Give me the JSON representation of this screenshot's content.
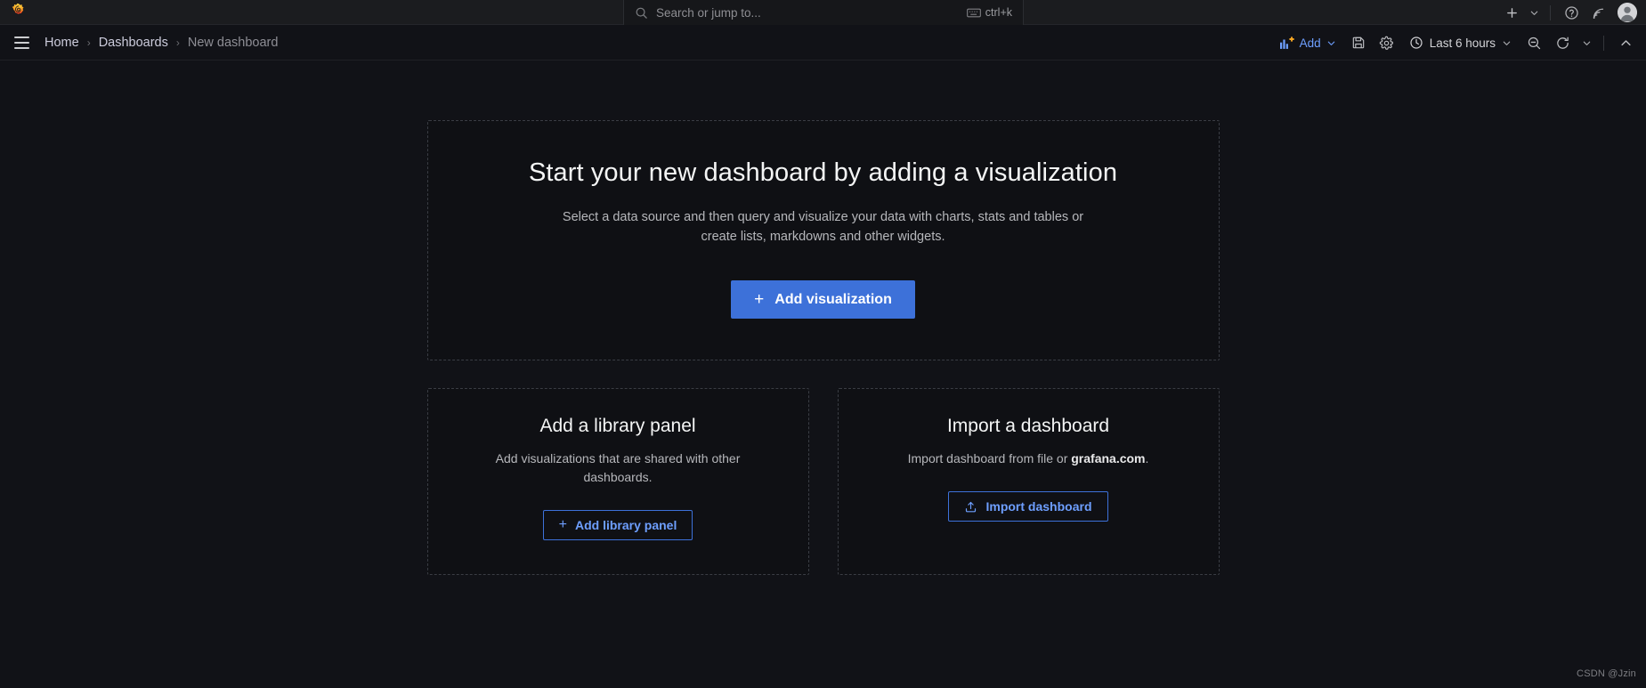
{
  "topbar": {
    "logo_icon": "grafana-logo",
    "search": {
      "placeholder": "Search or jump to...",
      "icon": "search-icon",
      "shortcut_label": "ctrl+k",
      "shortcut_icon": "keyboard-icon"
    },
    "actions": {
      "new_icon": "plus-icon",
      "new_chevron_icon": "chevron-down-icon",
      "help_icon": "help-circle-icon",
      "news_icon": "rss-icon",
      "profile_icon": "avatar"
    }
  },
  "navbar": {
    "menu_icon": "hamburger-menu-icon",
    "breadcrumb": [
      {
        "label": "Home",
        "current": false
      },
      {
        "label": "Dashboards",
        "current": false
      },
      {
        "label": "New dashboard",
        "current": true
      }
    ],
    "separator": "›",
    "add_label": "Add",
    "add_icon": "panel-add-icon",
    "add_chevron_icon": "chevron-down-icon",
    "save_icon": "save-floppy-icon",
    "settings_icon": "gear-icon",
    "time_range": {
      "icon": "clock-icon",
      "label": "Last 6 hours",
      "chevron_icon": "chevron-down-icon"
    },
    "zoom_out_icon": "search-minus-icon",
    "refresh_icon": "refresh-icon",
    "refresh_chevron_icon": "chevron-down-icon",
    "collapse_icon": "chevron-up-icon"
  },
  "main": {
    "hero": {
      "title": "Start your new dashboard by adding a visualization",
      "description": "Select a data source and then query and visualize your data with charts, stats and tables or create lists, markdowns and other widgets.",
      "button_label": "Add visualization",
      "button_icon": "plus-icon"
    },
    "cards": [
      {
        "title": "Add a library panel",
        "description": "Add visualizations that are shared with other dashboards.",
        "button_label": "Add library panel",
        "button_icon": "plus-icon"
      },
      {
        "title": "Import a dashboard",
        "description_before": "Import dashboard from file or ",
        "description_link": "grafana.com",
        "description_after": ".",
        "button_label": "Import dashboard",
        "button_icon": "upload-icon"
      }
    ]
  },
  "watermark": "CSDN @Jzin",
  "colors": {
    "accent_blue": "#3d71d9",
    "link_blue": "#6e9fff",
    "page_background": "#111217",
    "chrome_background": "#1b1c1f",
    "panel_border": "#3a3d44",
    "logo_orange": "#f05a28"
  }
}
